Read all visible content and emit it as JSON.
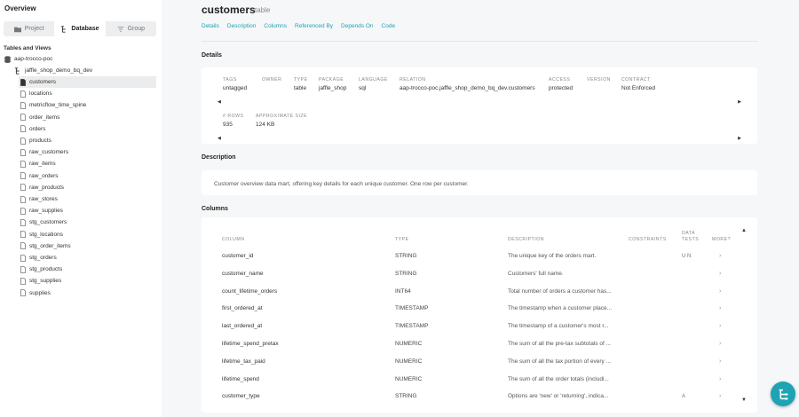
{
  "sidebar": {
    "overview": "Overview",
    "tabs": [
      {
        "label": "Project"
      },
      {
        "label": "Database"
      },
      {
        "label": "Group"
      }
    ],
    "section_title": "Tables and Views",
    "project": "aap-trocco-poc",
    "schema": "jaffle_shop_demo_bq_dev",
    "items": [
      "customers",
      "locations",
      "metricflow_time_spine",
      "order_items",
      "orders",
      "products",
      "raw_customers",
      "raw_items",
      "raw_orders",
      "raw_products",
      "raw_stores",
      "raw_supplies",
      "stg_customers",
      "stg_locations",
      "stg_order_items",
      "stg_orders",
      "stg_products",
      "stg_supplies",
      "supplies"
    ]
  },
  "header": {
    "title": "customers",
    "subtitle": "table",
    "links": [
      "Details",
      "Description",
      "Columns",
      "Referenced By",
      "Depends On",
      "Code"
    ]
  },
  "details": {
    "section_title": "Details",
    "row1": [
      {
        "label": "TAGS",
        "value": "untagged"
      },
      {
        "label": "OWNER",
        "value": ""
      },
      {
        "label": "TYPE",
        "value": "table"
      },
      {
        "label": "PACKAGE",
        "value": "jaffle_shop"
      },
      {
        "label": "LANGUAGE",
        "value": "sql"
      },
      {
        "label": "RELATION",
        "value": "aap-trocco-poc.jaffle_shop_demo_bq_dev.customers"
      },
      {
        "label": "ACCESS",
        "value": "protected"
      },
      {
        "label": "VERSION",
        "value": ""
      },
      {
        "label": "CONTRACT",
        "value": "Not Enforced"
      }
    ],
    "row2": [
      {
        "label": "# ROWS",
        "value": "935"
      },
      {
        "label": "APPROXIMATE SIZE",
        "value": "124 KB"
      }
    ],
    "scroll_left": "◀",
    "scroll_right": "▶"
  },
  "description": {
    "section_title": "Description",
    "text": "Customer overview data mart, offering key details for each unique customer. One row per customer."
  },
  "columns": {
    "section_title": "Columns",
    "headers": {
      "column": "COLUMN",
      "type": "TYPE",
      "description": "DESCRIPTION",
      "constraints": "CONSTRAINTS",
      "data_tests_1": "DATA",
      "data_tests_2": "TESTS",
      "more": "MORE?"
    },
    "rows": [
      {
        "column": "customer_id",
        "type": "STRING",
        "description": "The unique key of the orders mart.",
        "tests": "U N",
        "more": "›"
      },
      {
        "column": "customer_name",
        "type": "STRING",
        "description": "Customers' full name.",
        "tests": "",
        "more": "›"
      },
      {
        "column": "count_lifetime_orders",
        "type": "INT64",
        "description": "Total number of orders a customer has...",
        "tests": "",
        "more": "›"
      },
      {
        "column": "first_ordered_at",
        "type": "TIMESTAMP",
        "description": "The timestamp when a customer place...",
        "tests": "",
        "more": "›"
      },
      {
        "column": "last_ordered_at",
        "type": "TIMESTAMP",
        "description": "The timestamp of a customer's most r...",
        "tests": "",
        "more": "›"
      },
      {
        "column": "lifetime_spend_pretax",
        "type": "NUMERIC",
        "description": "The sum of all the pre-tax subtotals of ...",
        "tests": "",
        "more": "›"
      },
      {
        "column": "lifetime_tax_paid",
        "type": "NUMERIC",
        "description": "The sum of all the tax portion of every ...",
        "tests": "",
        "more": "›"
      },
      {
        "column": "lifetime_spend",
        "type": "NUMERIC",
        "description": "The sum of all the order totals (includi...",
        "tests": "",
        "more": "›"
      },
      {
        "column": "customer_type",
        "type": "STRING",
        "description": "Options are 'new' or 'returning', indica...",
        "tests": "A",
        "more": "›"
      }
    ],
    "scroll_up": "▲",
    "scroll_down": "▼"
  },
  "colors": {
    "accent": "#1ea3b4"
  }
}
